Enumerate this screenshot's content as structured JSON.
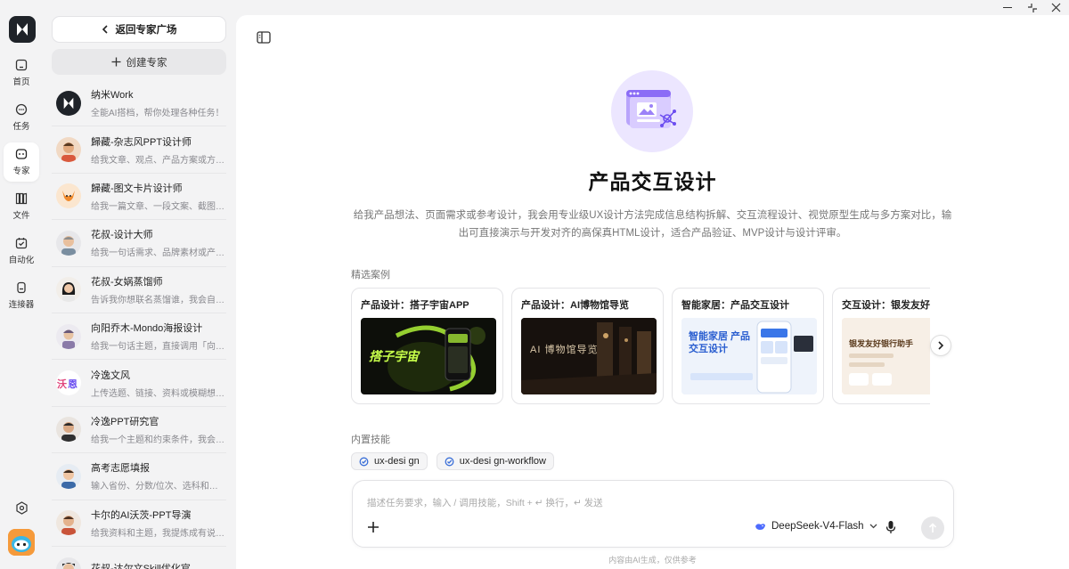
{
  "nav": {
    "items": [
      {
        "label": "首页",
        "icon": "home-icon"
      },
      {
        "label": "任务",
        "icon": "chat-icon"
      },
      {
        "label": "专家",
        "icon": "expert-icon",
        "active": true
      },
      {
        "label": "文件",
        "icon": "files-icon"
      },
      {
        "label": "自动化",
        "icon": "automation-icon"
      },
      {
        "label": "连接器",
        "icon": "connector-icon"
      }
    ]
  },
  "panel": {
    "back_label": "返回专家广场",
    "create_label": "创建专家",
    "experts": [
      {
        "name": "纳米Work",
        "desc": "全能AI搭档，帮你处理各种任务！"
      },
      {
        "name": "歸藏-杂志风PPT设计师",
        "desc": "给我文章、观点、产品方案或方法论，我会..."
      },
      {
        "name": "歸藏-图文卡片设计师",
        "desc": "给我一篇文章、一段文案、截图或网页..."
      },
      {
        "name": "花叔-设计大师",
        "desc": "给我一句话需求、品牌素材或产品截图..."
      },
      {
        "name": "花叔-女娲蒸馏师",
        "desc": "告诉我你想联名蒸馏谁，我会自动搜集..."
      },
      {
        "name": "向阳乔木-Mondo海报设计",
        "desc": "给我一句话主题，直接调用「向日葵..."
      },
      {
        "name": "冷逸文风",
        "desc": "上传选题、链接、资料或模糊想法，我..."
      },
      {
        "name": "冷逸PPT研究官",
        "desc": "给我一个主题和约束条件，我会用..."
      },
      {
        "name": "高考志愿填报",
        "desc": "输入省份、分数/位次、选科和目标..."
      },
      {
        "name": "卡尔的AI沃茨-PPT导演",
        "desc": "给我资料和主题，我提炼成有说服力..."
      },
      {
        "name": "花叔-达尔文Skill优化官",
        "desc": ""
      }
    ]
  },
  "main": {
    "title": "产品交互设计",
    "description": "给我产品想法、页面需求或参考设计，我会用专业级UX设计方法完成信息结构拆解、交互流程设计、视觉原型生成与多方案对比，输出可直接演示与开发对齐的高保真HTML设计，适合产品验证、MVP设计与设计评审。",
    "cases_label": "精选案例",
    "cases": [
      {
        "title": "产品设计：搭子宇宙APP",
        "thumb_text": "搭子宇宙"
      },
      {
        "title": "产品设计：AI博物馆导览",
        "thumb_text": "AI 博物馆导览"
      },
      {
        "title": "智能家居：产品交互设计",
        "thumb_text": "智能家居 产品交互设计"
      },
      {
        "title": "交互设计：银发友好银行助手",
        "thumb_text": "银发友好银行助手"
      }
    ],
    "skills_label": "内置技能",
    "skills": [
      "ux-desi gn",
      "ux-desi gn-workflow"
    ],
    "composer": {
      "placeholder": "描述任务要求，输入 / 调用技能，Shift + ↵ 换行，↵ 发送",
      "model": "DeepSeek-V4-Flash"
    },
    "footer_note": "内容由AI生成，仅供参考"
  },
  "colors": {
    "accent_purple": "#8b6cf6",
    "hero_bg": "#ece6ff"
  }
}
